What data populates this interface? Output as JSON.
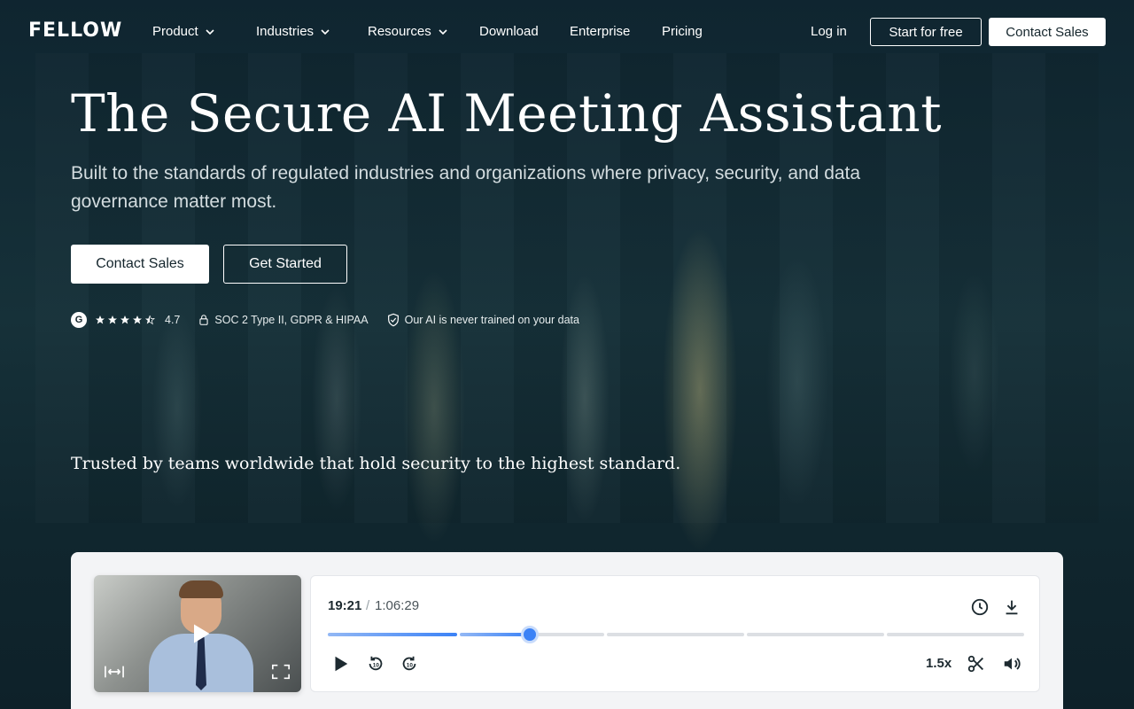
{
  "nav": {
    "logo": "FELLOW",
    "items": [
      {
        "label": "Product",
        "dropdown": true
      },
      {
        "label": "Industries",
        "dropdown": true
      },
      {
        "label": "Resources",
        "dropdown": true
      },
      {
        "label": "Download",
        "dropdown": false
      },
      {
        "label": "Enterprise",
        "dropdown": false
      },
      {
        "label": "Pricing",
        "dropdown": false
      }
    ],
    "login": "Log in",
    "start_free": "Start for free",
    "contact_sales": "Contact Sales"
  },
  "hero": {
    "title": "The Secure AI Meeting Assistant",
    "subtitle": "Built to the standards of regulated industries and organizations where privacy, security, and data governance matter most.",
    "cta_primary": "Contact Sales",
    "cta_secondary": "Get Started",
    "badges": {
      "g2_letter": "G",
      "rating": "4.7",
      "stars": 4.5,
      "compliance": "SOC 2 Type II, GDPR & HIPAA",
      "ai_note": "Our AI is never trained on your data"
    },
    "trusted": "Trusted by teams worldwide that hold security to the highest standard."
  },
  "player": {
    "current_time": "19:21",
    "separator": "/",
    "total_time": "1:06:29",
    "progress": 0.29,
    "speed": "1.5x",
    "icons": [
      "play-icon",
      "rewind-10-icon",
      "forward-10-icon",
      "clock-icon",
      "download-icon",
      "scissors-icon",
      "volume-icon",
      "expand-width-icon",
      "fullscreen-icon"
    ]
  },
  "colors": {
    "background": "#122a33",
    "accent": "#3b82f6",
    "button_text": "#15262d"
  }
}
